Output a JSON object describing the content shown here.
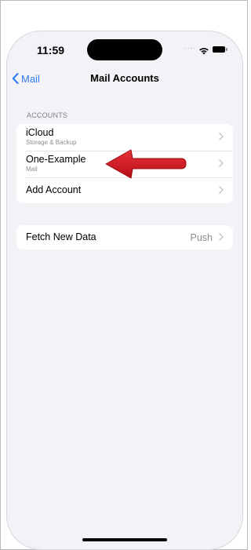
{
  "status_bar": {
    "time": "11:59",
    "signal_dots": "....",
    "wifi_icon": "wifi-icon",
    "battery_icon": "battery-icon"
  },
  "nav": {
    "back_label": "Mail",
    "back_icon": "chevron-left-icon",
    "title": "Mail Accounts"
  },
  "accounts_section": {
    "header": "ACCOUNTS",
    "items": [
      {
        "title": "iCloud",
        "subtitle": "Storage & Backup"
      },
      {
        "title": "One-Example",
        "subtitle": "Mail"
      },
      {
        "title": "Add Account",
        "subtitle": ""
      }
    ]
  },
  "fetch_section": {
    "title": "Fetch New Data",
    "value": "Push"
  },
  "colors": {
    "accent": "#2f7cf6",
    "background": "#f2f2f7",
    "annotation_arrow": "#d0121d"
  }
}
